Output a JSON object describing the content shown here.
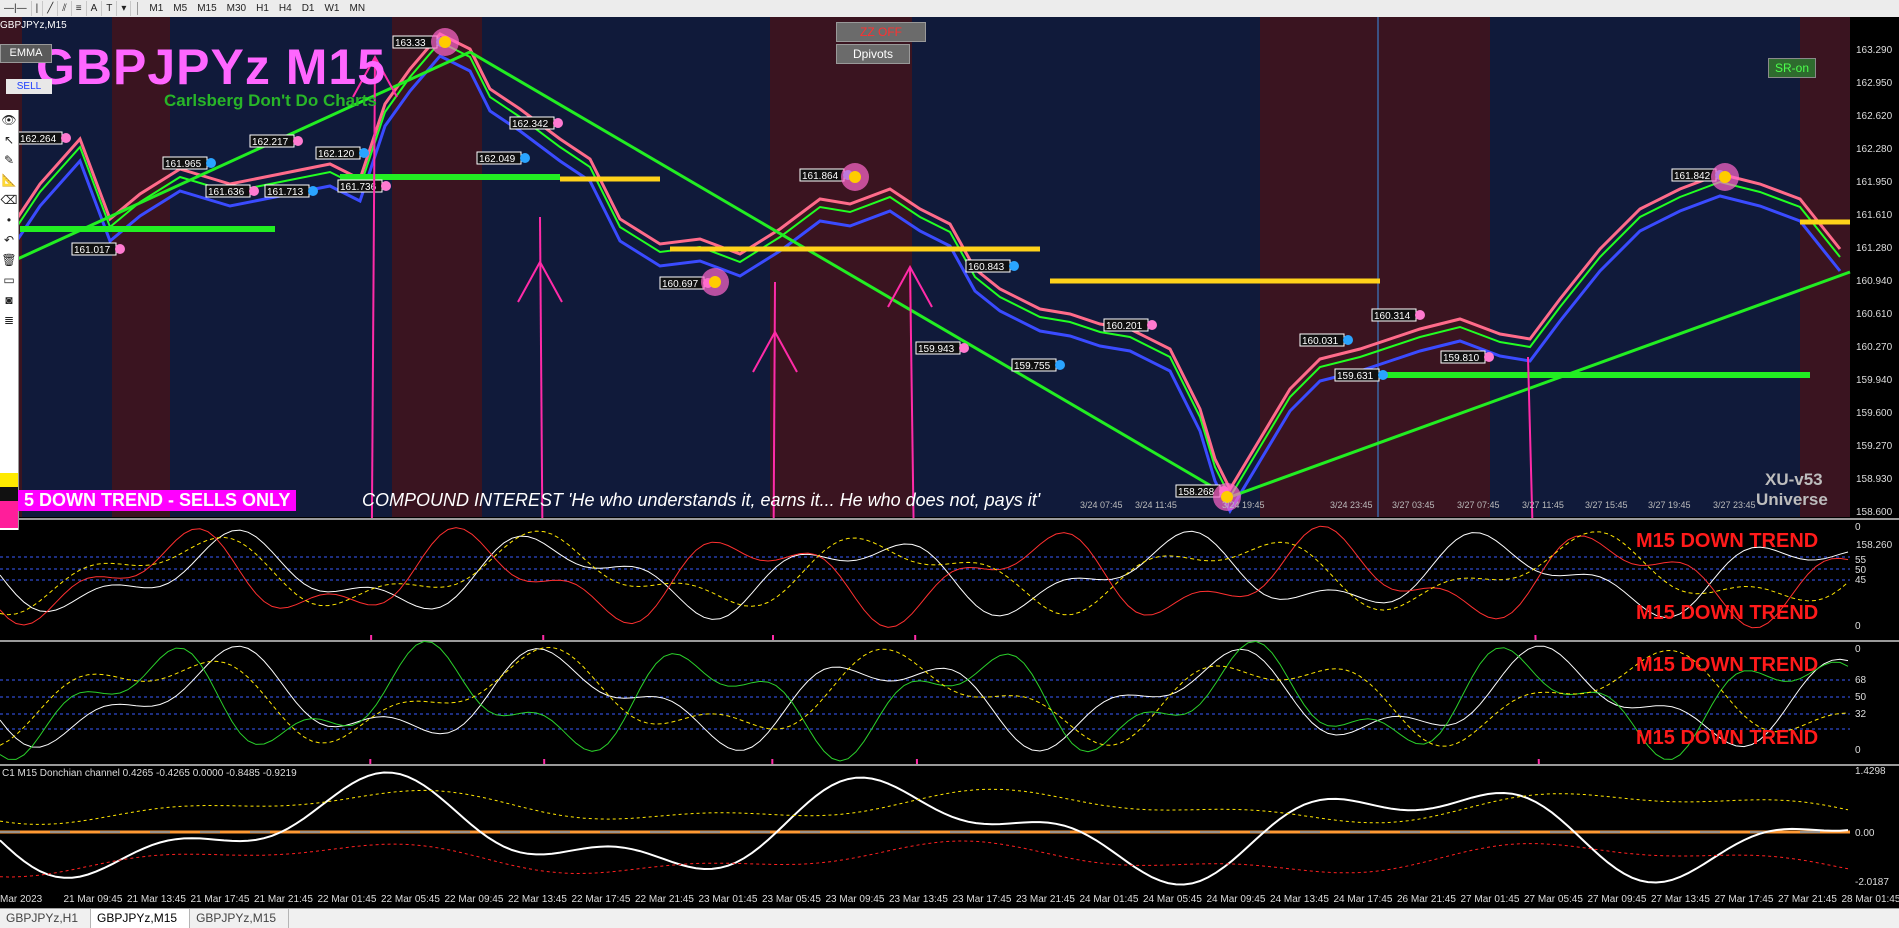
{
  "toolbar": {
    "timeframes": [
      "M1",
      "M5",
      "M15",
      "M30",
      "H1",
      "H4",
      "D1",
      "W1",
      "MN"
    ],
    "tools": [
      "A",
      "T"
    ]
  },
  "chart_header": {
    "symbol_label": "GBPJPYz,M15",
    "big_title": "GBPJPYz M15",
    "subtitle": "Carlsberg Don't Do Charts"
  },
  "buttons": {
    "emma": "EMMA",
    "sell": "SELL",
    "zz_off": "ZZ OFF",
    "dpivots": "Dpivots",
    "sr_on": "SR-on"
  },
  "banner": {
    "trend": "5  DOWN TREND - SELLS ONLY",
    "quote": "COMPOUND INTEREST 'He who understands it, earns it... He who does not, pays it'"
  },
  "watermark": {
    "version": "XU-v53",
    "name": "Universe"
  },
  "price_axis": [
    "163.290",
    "162.950",
    "162.620",
    "162.280",
    "161.950",
    "161.610",
    "161.280",
    "160.940",
    "160.610",
    "160.270",
    "159.940",
    "159.600",
    "159.270",
    "158.930",
    "158.600",
    "158.260"
  ],
  "price_labels": [
    "162.264",
    "161.965",
    "161.636",
    "161.713",
    "162.217",
    "162.120",
    "161.736",
    "162.049",
    "162.342",
    "163.33",
    "161.017",
    "161.864",
    "160.697",
    "160.843",
    "159.943",
    "159.755",
    "160.201",
    "160.031",
    "160.314",
    "159.631",
    "159.810",
    "161.842",
    "158.268"
  ],
  "main_time_labels": [
    "3/24 07:45",
    "3/24 11:45",
    "3/24 19:45",
    "3/24 23:45",
    "3/27 03:45",
    "3/27 07:45",
    "3/27 11:45",
    "3/27 15:45",
    "3/27 19:45",
    "3/27 23:45"
  ],
  "indicator1": {
    "scale": [
      "0",
      "55",
      "50",
      "45",
      "0"
    ],
    "labels": [
      "M15 DOWN TREND",
      "M15 DOWN TREND"
    ]
  },
  "indicator2": {
    "scale": [
      "0",
      "68",
      "50",
      "32",
      "0"
    ],
    "labels": [
      "M15 DOWN TREND",
      "M15 DOWN TREND"
    ]
  },
  "indicator3": {
    "caption": "C1 M15 Donchian channel 0.4265 -0.4265 0.0000 -0.8485 -0.9219",
    "scale": [
      "1.4298",
      "0.00",
      "-2.0187"
    ]
  },
  "bottom_time_axis": [
    "Mar 2023",
    "21 Mar 09:45",
    "21 Mar 13:45",
    "21 Mar 17:45",
    "21 Mar 21:45",
    "22 Mar 01:45",
    "22 Mar 05:45",
    "22 Mar 09:45",
    "22 Mar 13:45",
    "22 Mar 17:45",
    "22 Mar 21:45",
    "23 Mar 01:45",
    "23 Mar 05:45",
    "23 Mar 09:45",
    "23 Mar 13:45",
    "23 Mar 17:45",
    "23 Mar 21:45",
    "24 Mar 01:45",
    "24 Mar 05:45",
    "24 Mar 09:45",
    "24 Mar 13:45",
    "24 Mar 17:45",
    "26 Mar 21:45",
    "27 Mar 01:45",
    "27 Mar 05:45",
    "27 Mar 09:45",
    "27 Mar 13:45",
    "27 Mar 17:45",
    "27 Mar 21:45",
    "28 Mar 01:45"
  ],
  "tabs": [
    "GBPJPYz,H1",
    "GBPJPYz,M15",
    "GBPJPYz,M15"
  ],
  "colors": {
    "bg_navy": "#101a3a",
    "bg_maroon": "#3a1420",
    "trend_green": "#22ee22",
    "level_yellow": "#ffd21a",
    "arrow_pink": "#ff2ba8",
    "price_green": "#22ff22"
  }
}
